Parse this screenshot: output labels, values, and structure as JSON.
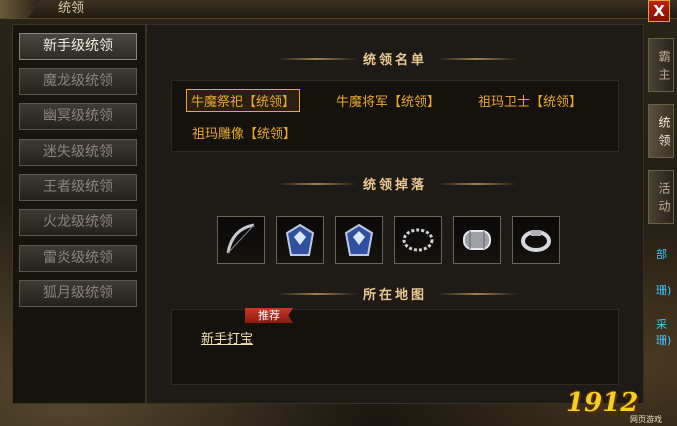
{
  "window": {
    "title": "统领",
    "close_label": "X"
  },
  "nav": {
    "items": [
      {
        "label": "新手级统领",
        "active": true
      },
      {
        "label": "魔龙级统领",
        "active": false
      },
      {
        "label": "幽冥级统领",
        "active": false
      },
      {
        "label": "迷失级统领",
        "active": false
      },
      {
        "label": "王者级统领",
        "active": false
      },
      {
        "label": "火龙级统领",
        "active": false
      },
      {
        "label": "雷炎级统领",
        "active": false
      },
      {
        "label": "狐月级统领",
        "active": false
      }
    ]
  },
  "sections": {
    "commanders_title": "统领名单",
    "drops_title": "统领掉落",
    "location_title": "所在地图"
  },
  "commanders": [
    {
      "label": "牛魔祭祀【统领】",
      "selected": true
    },
    {
      "label": "牛魔将军【统领】",
      "selected": false
    },
    {
      "label": "祖玛卫士【统领】",
      "selected": false
    },
    {
      "label": "祖玛雕像【统领】",
      "selected": false
    }
  ],
  "drops": [
    {
      "icon": "bow-icon"
    },
    {
      "icon": "armor-blue-icon"
    },
    {
      "icon": "armor-blue-icon"
    },
    {
      "icon": "necklace-icon"
    },
    {
      "icon": "bracelet-icon"
    },
    {
      "icon": "ring-icon"
    }
  ],
  "location": {
    "badge": "推荐",
    "map": "新手打宝"
  },
  "side_tabs": [
    {
      "label": "霸主",
      "active": false
    },
    {
      "label": "统领",
      "active": true
    },
    {
      "label": "活动",
      "active": false
    }
  ],
  "side_tips": [
    "部",
    "珊)",
    "采珊)"
  ],
  "logo": {
    "text": "1912",
    "sub": "网页游戏"
  },
  "colors": {
    "accent": "#e8a830",
    "title": "#e8c890",
    "link_tip": "#40c8ff"
  }
}
